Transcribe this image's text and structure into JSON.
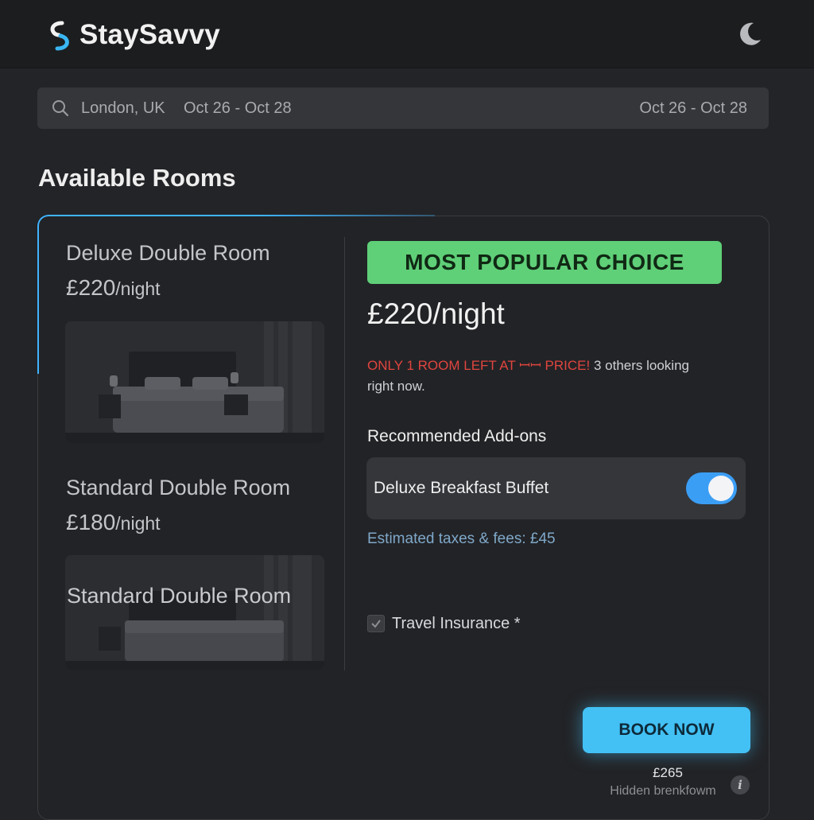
{
  "header": {
    "brand": "StaySavvy",
    "logo_icon": "swirl-s-logo-icon",
    "theme_icon": "moon-icon"
  },
  "search": {
    "icon": "search-icon",
    "location": "London, UK",
    "dates": "Oct 26 - Oct 28",
    "dates_right": "Oct 26 - Oct 28"
  },
  "main": {
    "section_title": "Available Rooms"
  },
  "rooms": [
    {
      "name": "Deluxe Double Room",
      "price": "£220",
      "unit": "/night"
    },
    {
      "name": "Standard Double Room",
      "price": "£180",
      "unit": "/night",
      "image_caption": "Standard Double Room"
    }
  ],
  "detail": {
    "badge": "MOST POPULAR CHOICE",
    "price": "£220/night",
    "urgency_red": "ONLY 1 ROOM LEFT AT ꟷꟷ PRICE!",
    "urgency_rest": " 3 others looking right now.",
    "addons_title": "Recommended Add-ons",
    "addon_label": "Deluxe Breakfast Buffet",
    "addon_enabled": true,
    "taxes": "Estimated taxes & fees: £45",
    "insurance_label": "Travel Insurance *",
    "insurance_checked": true,
    "book_button": "BOOK NOW",
    "total": "£265",
    "hidden_note": "Hidden brenkfowm",
    "info_glyph": "i"
  },
  "colors": {
    "background": "#232427",
    "badge": "#5fcf78",
    "accent": "#43c1f5",
    "toggle": "#3b9ef5",
    "urgency": "#e0453f"
  }
}
